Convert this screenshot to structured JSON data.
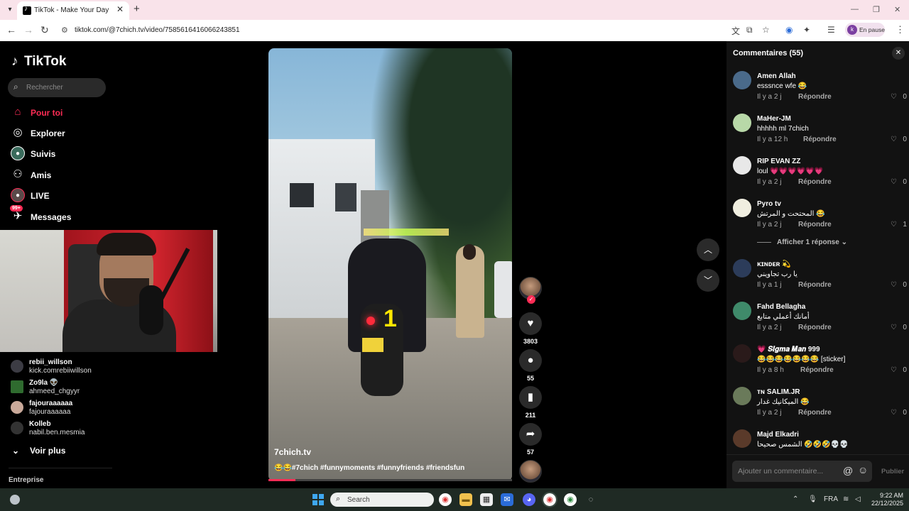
{
  "browser": {
    "tab_title": "TikTok - Make Your Day",
    "url": "tiktok.com/@7chich.tv/video/7585616416066243851",
    "profile_label": "En pause",
    "profile_initial": "k"
  },
  "sidebar": {
    "logo": "TikTok",
    "search_placeholder": "Rechercher",
    "nav": [
      {
        "label": "Pour toi",
        "icon": "home-icon"
      },
      {
        "label": "Explorer",
        "icon": "compass-icon"
      },
      {
        "label": "Suivis",
        "icon": "following-icon"
      },
      {
        "label": "Amis",
        "icon": "friends-icon"
      },
      {
        "label": "LIVE",
        "icon": "live-icon"
      },
      {
        "label": "Messages",
        "icon": "messages-icon",
        "badge": "99+"
      }
    ],
    "following": [
      {
        "name": "rebii_willson",
        "handle": "kick.comrebiiwillson"
      },
      {
        "name": "Zo9la 👽",
        "handle": "ahmeed_chgyyr"
      },
      {
        "name": "fajouraaaaaa",
        "handle": "fajouraaaaaa"
      },
      {
        "name": "Kolleb",
        "handle": "nabil.ben.mesmia"
      }
    ],
    "see_more": "Voir plus",
    "footer": "Entreprise"
  },
  "video": {
    "author": "7chich.tv",
    "description": "😂😂#7chich #funnymoments #funnyfriends #friendsfun",
    "overlay_number": "1",
    "progress": 0.11,
    "likes": "3803",
    "comments": "55",
    "saves": "211",
    "shares": "57"
  },
  "comments_panel": {
    "title": "Commentaires (55)",
    "reply_label": "Répondre",
    "show_replies": "Afficher 1 réponse",
    "input_placeholder": "Ajouter un commentaire...",
    "publish": "Publier",
    "items": [
      {
        "name": "Amen Allah",
        "text": "esssnce wfe 😂",
        "time": "Il y a 2 j",
        "likes": "0"
      },
      {
        "name": "MaHer-JM",
        "text": "hhhhh ml 7chich",
        "time": "Il y a 12 h",
        "likes": "0"
      },
      {
        "name": "RIP EVAN ZZ",
        "text": "loul 💗💗💗💗💗💗",
        "time": "Il y a 2 j",
        "likes": "0"
      },
      {
        "name": "Pyro tv",
        "text": "المحتحت و المرتش 😂",
        "time": "Il y a 2 j",
        "likes": "1"
      },
      {
        "name": "ᴋɪɴᴅᴇʀ 💫",
        "text": "يا رب تجاويني",
        "time": "Il y a 1 j",
        "likes": "0"
      },
      {
        "name": "Fahd Bellagha",
        "text": "أمانك أعملي متابع",
        "time": "Il y a 2 j",
        "likes": "0"
      },
      {
        "name": "💗 𝑺𝒊𝒈𝒎𝒂 𝑴𝒂𝒏 999",
        "text": "😂😂😂😂😂😂😂 [sticker]",
        "time": "Il y a 8 h",
        "likes": "0"
      },
      {
        "name": "ᴛɴ SALIM.JR",
        "text": "الميكانيك غدار 😂",
        "time": "Il y a 2 j",
        "likes": "0"
      },
      {
        "name": "Majd Elkadri",
        "text": "الشمس صحيحا 🤣🤣🤣💀💀",
        "time": "",
        "likes": ""
      }
    ]
  },
  "taskbar": {
    "search_label": "Search",
    "language": "FRA",
    "time": "9:22 AM",
    "date": "22/12/2025"
  },
  "colors": {
    "accent": "#fe2c55",
    "tab_bar": "#f9e3ea",
    "panel_bg": "#121212"
  }
}
